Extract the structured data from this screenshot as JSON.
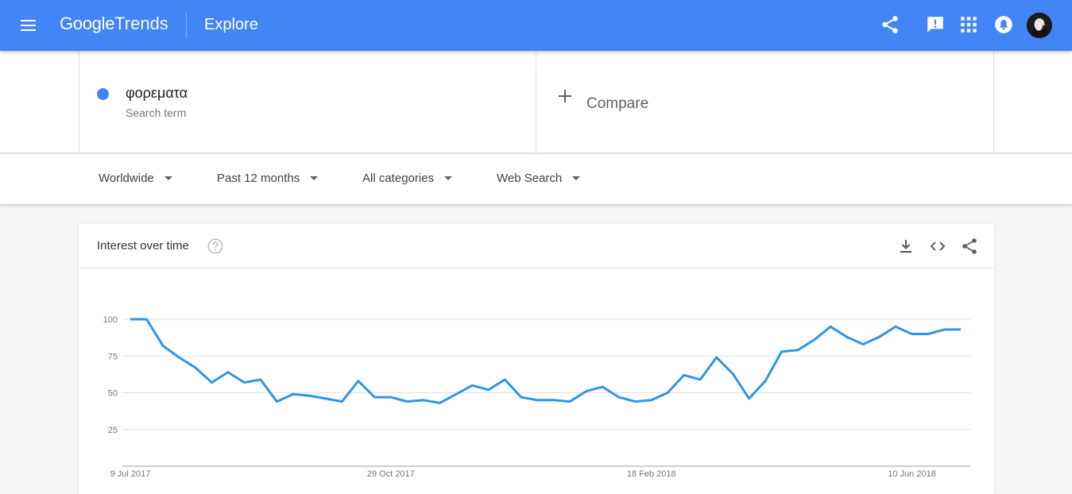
{
  "appbar": {
    "logo_google": "Google",
    "logo_trends": "Trends",
    "section": "Explore",
    "colors": {
      "bar": "#4285f4"
    },
    "icons": [
      "menu-icon",
      "share-icon",
      "feedback-icon",
      "apps-icon",
      "notifications-icon",
      "avatar"
    ]
  },
  "search": {
    "term": "φορεματα",
    "term_sub": "Search term",
    "term_color": "#4285f4",
    "compare_label": "Compare"
  },
  "filters": {
    "region": "Worldwide",
    "time": "Past 12 months",
    "category": "All categories",
    "property": "Web Search"
  },
  "card": {
    "title": "Interest over time",
    "icons": [
      "help-icon",
      "download-icon",
      "embed-icon",
      "share-icon"
    ]
  },
  "chart_data": {
    "type": "line",
    "title": "",
    "xlabel": "",
    "ylabel": "",
    "ylim": [
      0,
      100
    ],
    "y_ticks": [
      "25",
      "50",
      "75",
      "100"
    ],
    "x_ticks": [
      "9 Jul 2017",
      "29 Oct 2017",
      "18 Feb 2018",
      "10 Jun 2018"
    ],
    "grid": true,
    "series": [
      {
        "color": "#2e96e6",
        "x": [
          "2017-07-09",
          "2017-07-16",
          "2017-07-23",
          "2017-07-30",
          "2017-08-06",
          "2017-08-13",
          "2017-08-20",
          "2017-08-27",
          "2017-09-03",
          "2017-09-10",
          "2017-09-17",
          "2017-09-24",
          "2017-10-01",
          "2017-10-08",
          "2017-10-15",
          "2017-10-22",
          "2017-10-29",
          "2017-11-05",
          "2017-11-12",
          "2017-11-19",
          "2017-11-26",
          "2017-12-03",
          "2017-12-10",
          "2017-12-17",
          "2017-12-24",
          "2017-12-31",
          "2018-01-07",
          "2018-01-14",
          "2018-01-21",
          "2018-01-28",
          "2018-02-04",
          "2018-02-11",
          "2018-02-18",
          "2018-02-25",
          "2018-03-04",
          "2018-03-11",
          "2018-03-18",
          "2018-03-25",
          "2018-04-01",
          "2018-04-08",
          "2018-04-15",
          "2018-04-22",
          "2018-04-29",
          "2018-05-06",
          "2018-05-13",
          "2018-05-20",
          "2018-05-27",
          "2018-06-03",
          "2018-06-10",
          "2018-06-17",
          "2018-06-24",
          "2018-07-01"
        ],
        "values": [
          100,
          100,
          82,
          74,
          67,
          57,
          64,
          57,
          59,
          44,
          49,
          48,
          46,
          44,
          58,
          47,
          47,
          44,
          45,
          43,
          49,
          55,
          52,
          59,
          47,
          45,
          45,
          44,
          51,
          54,
          47,
          44,
          45,
          50,
          62,
          59,
          74,
          63,
          46,
          58,
          78,
          79,
          86,
          95,
          88,
          83,
          88,
          95,
          90,
          90,
          93,
          93
        ]
      }
    ]
  }
}
